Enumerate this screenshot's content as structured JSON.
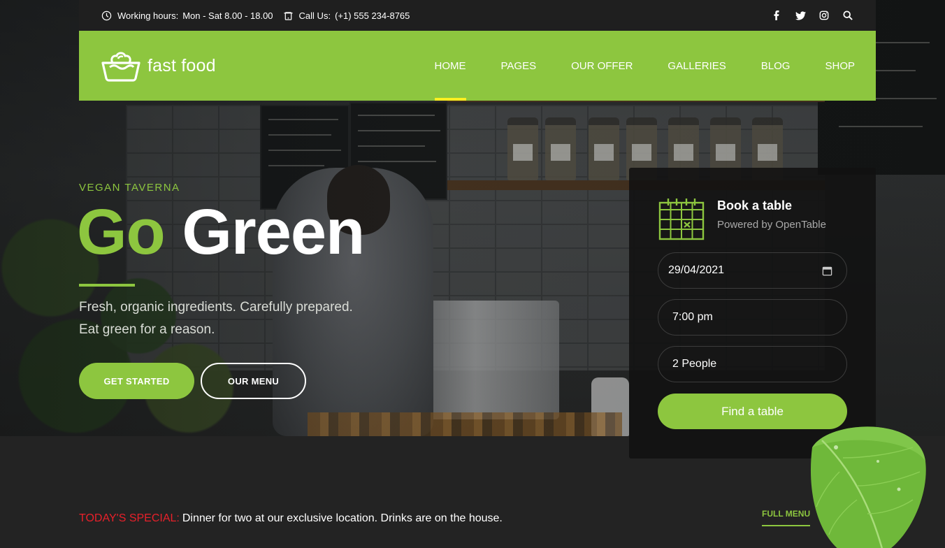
{
  "topbar": {
    "hours_label": "Working hours:",
    "hours_value": "Mon - Sat 8.00 - 18.00",
    "call_label": "Call Us:",
    "call_value": "(+1) 555 234-8765",
    "icons": [
      "clock-icon",
      "phone-icon",
      "facebook-icon",
      "twitter-icon",
      "instagram-icon",
      "search-icon"
    ]
  },
  "nav": {
    "logo_text": "fast food",
    "items": [
      {
        "label": "HOME",
        "active": true
      },
      {
        "label": "PAGES"
      },
      {
        "label": "OUR OFFER"
      },
      {
        "label": "GALLERIES"
      },
      {
        "label": "BLOG"
      },
      {
        "label": "SHOP"
      }
    ]
  },
  "hero": {
    "eyebrow": "VEGAN TAVERNA",
    "headline_green": "Go",
    "headline_white": "Green",
    "sub_line1": "Fresh, organic ingredients. Carefully prepared.",
    "sub_line2": "Eat green for a reason.",
    "primary_button": "GET STARTED",
    "secondary_button": "OUR MENU"
  },
  "booking": {
    "title": "Book a table",
    "powered_by": "Powered by OpenTable",
    "date_value": "29/04/2021",
    "time_value": "7:00 pm",
    "people_value": "2 People",
    "submit_label": "Find a table"
  },
  "special": {
    "tag": "TODAY'S SPECIAL:",
    "text": "Dinner for two at our exclusive location. Drinks are on the house.",
    "full_menu_link": "FULL MENU"
  },
  "colors": {
    "brand_green": "#8dc63f",
    "active_underline": "#fcee21",
    "special_red": "#e8202a",
    "dark_bg": "#232323"
  }
}
